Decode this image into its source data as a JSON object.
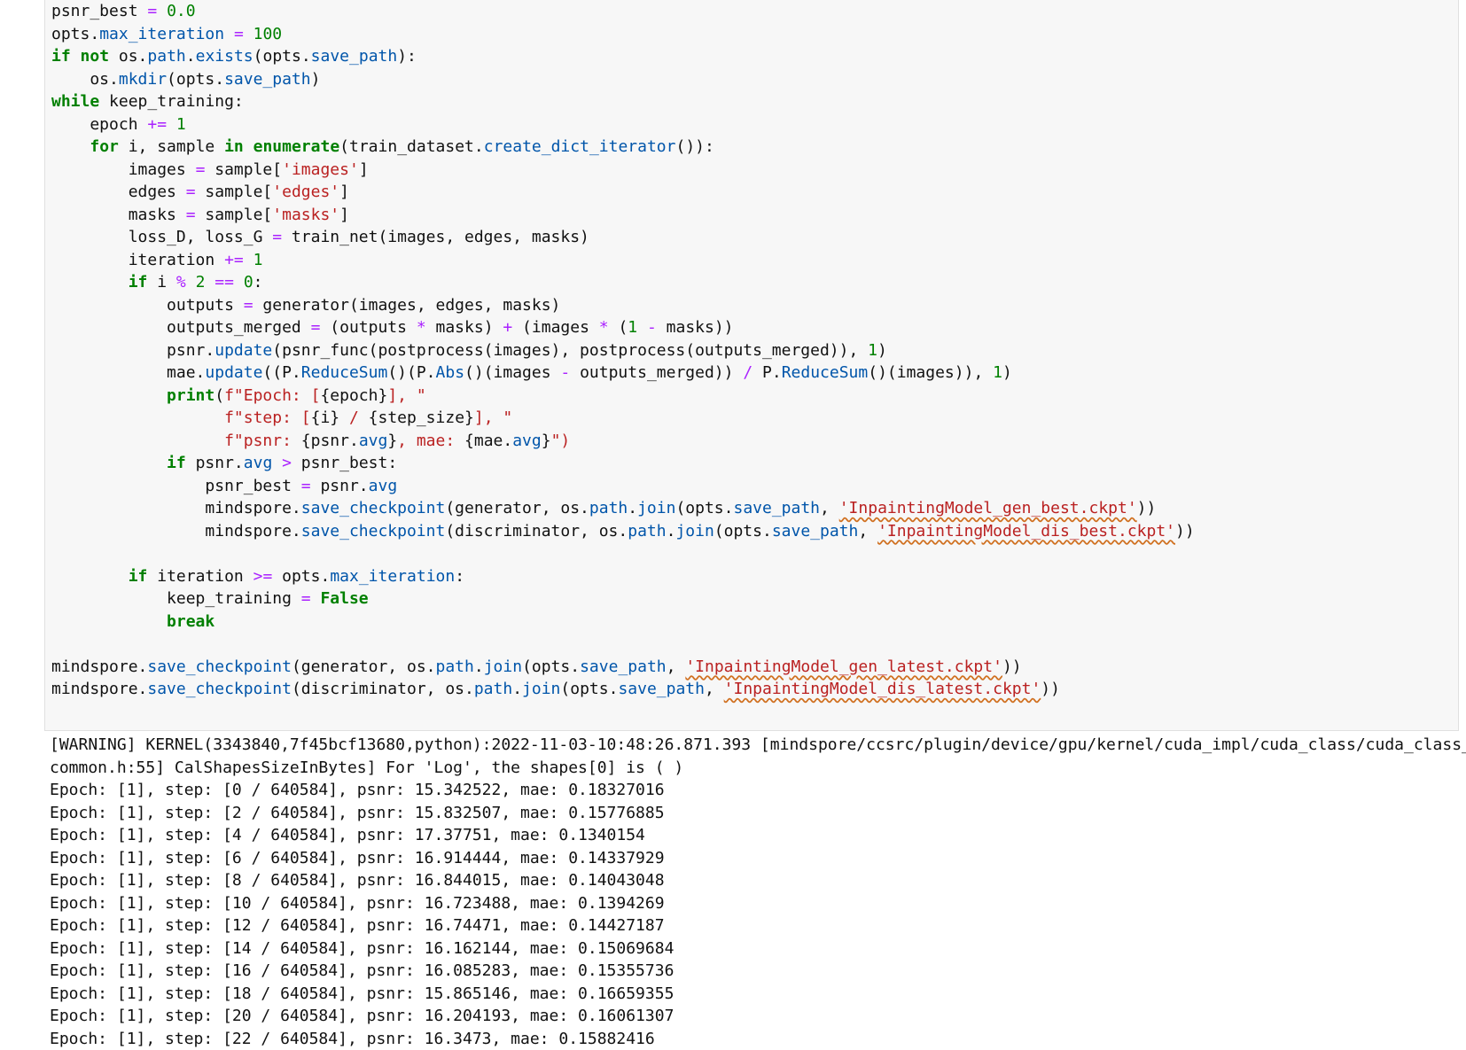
{
  "code_lines": [
    [
      [
        "psnr_best ",
        "var"
      ],
      [
        "=",
        "op"
      ],
      [
        " ",
        "var"
      ],
      [
        "0.0",
        "num"
      ]
    ],
    [
      [
        "opts",
        "var"
      ],
      [
        ".",
        "var"
      ],
      [
        "max_iteration",
        "attr"
      ],
      [
        " ",
        "var"
      ],
      [
        "=",
        "op"
      ],
      [
        " ",
        "var"
      ],
      [
        "100",
        "num"
      ]
    ],
    [
      [
        "if",
        "kw"
      ],
      [
        " ",
        "var"
      ],
      [
        "not",
        "kw"
      ],
      [
        " os.",
        "var"
      ],
      [
        "path",
        "attr"
      ],
      [
        ".",
        "var"
      ],
      [
        "exists",
        "attr"
      ],
      [
        "(opts.",
        "var"
      ],
      [
        "save_path",
        "attr"
      ],
      [
        "):",
        "var"
      ]
    ],
    [
      [
        "    os.",
        "var"
      ],
      [
        "mkdir",
        "attr"
      ],
      [
        "(opts.",
        "var"
      ],
      [
        "save_path",
        "attr"
      ],
      [
        ")",
        "var"
      ]
    ],
    [
      [
        "while",
        "kw"
      ],
      [
        " keep_training:",
        "var"
      ]
    ],
    [
      [
        "    epoch ",
        "var"
      ],
      [
        "+=",
        "op"
      ],
      [
        " ",
        "var"
      ],
      [
        "1",
        "num"
      ]
    ],
    [
      [
        "    ",
        "var"
      ],
      [
        "for",
        "kw"
      ],
      [
        " i, sample ",
        "var"
      ],
      [
        "in",
        "kw"
      ],
      [
        " ",
        "var"
      ],
      [
        "enumerate",
        "kw"
      ],
      [
        "(train_dataset.",
        "var"
      ],
      [
        "create_dict_iterator",
        "attr"
      ],
      [
        "()):",
        "var"
      ]
    ],
    [
      [
        "        images ",
        "var"
      ],
      [
        "=",
        "op"
      ],
      [
        " sample[",
        "var"
      ],
      [
        "'images'",
        "str"
      ],
      [
        "]",
        "var"
      ]
    ],
    [
      [
        "        edges ",
        "var"
      ],
      [
        "=",
        "op"
      ],
      [
        " sample[",
        "var"
      ],
      [
        "'edges'",
        "str"
      ],
      [
        "]",
        "var"
      ]
    ],
    [
      [
        "        masks ",
        "var"
      ],
      [
        "=",
        "op"
      ],
      [
        " sample[",
        "var"
      ],
      [
        "'masks'",
        "str"
      ],
      [
        "]",
        "var"
      ]
    ],
    [
      [
        "        loss_D, loss_G ",
        "var"
      ],
      [
        "=",
        "op"
      ],
      [
        " train_net(images, edges, masks)",
        "var"
      ]
    ],
    [
      [
        "        iteration ",
        "var"
      ],
      [
        "+=",
        "op"
      ],
      [
        " ",
        "var"
      ],
      [
        "1",
        "num"
      ]
    ],
    [
      [
        "        ",
        "var"
      ],
      [
        "if",
        "kw"
      ],
      [
        " i ",
        "var"
      ],
      [
        "%",
        "op"
      ],
      [
        " ",
        "var"
      ],
      [
        "2",
        "num"
      ],
      [
        " ",
        "var"
      ],
      [
        "==",
        "op"
      ],
      [
        " ",
        "var"
      ],
      [
        "0",
        "num"
      ],
      [
        ":",
        "var"
      ]
    ],
    [
      [
        "            outputs ",
        "var"
      ],
      [
        "=",
        "op"
      ],
      [
        " generator(images, edges, masks)",
        "var"
      ]
    ],
    [
      [
        "            outputs_merged ",
        "var"
      ],
      [
        "=",
        "op"
      ],
      [
        " (outputs ",
        "var"
      ],
      [
        "*",
        "op"
      ],
      [
        " masks) ",
        "var"
      ],
      [
        "+",
        "op"
      ],
      [
        " (images ",
        "var"
      ],
      [
        "*",
        "op"
      ],
      [
        " (",
        "var"
      ],
      [
        "1",
        "num"
      ],
      [
        " ",
        "var"
      ],
      [
        "-",
        "op"
      ],
      [
        " masks))",
        "var"
      ]
    ],
    [
      [
        "            psnr.",
        "var"
      ],
      [
        "update",
        "attr"
      ],
      [
        "(psnr_func(postprocess(images), postprocess(outputs_merged)), ",
        "var"
      ],
      [
        "1",
        "num"
      ],
      [
        ")",
        "var"
      ]
    ],
    [
      [
        "            mae.",
        "var"
      ],
      [
        "update",
        "attr"
      ],
      [
        "((P.",
        "var"
      ],
      [
        "ReduceSum",
        "attr"
      ],
      [
        "()(P.",
        "var"
      ],
      [
        "Abs",
        "attr"
      ],
      [
        "()(images ",
        "var"
      ],
      [
        "-",
        "op"
      ],
      [
        " outputs_merged)) ",
        "var"
      ],
      [
        "/",
        "op"
      ],
      [
        " P.",
        "var"
      ],
      [
        "ReduceSum",
        "attr"
      ],
      [
        "()(images)), ",
        "var"
      ],
      [
        "1",
        "num"
      ],
      [
        ")",
        "var"
      ]
    ],
    [
      [
        "            ",
        "var"
      ],
      [
        "print",
        "kw"
      ],
      [
        "(",
        "var"
      ],
      [
        "f\"Epoch: [",
        "str"
      ],
      [
        "{epoch}",
        "var"
      ],
      [
        "], \"",
        "str"
      ]
    ],
    [
      [
        "                  ",
        "var"
      ],
      [
        "f\"step: [",
        "str"
      ],
      [
        "{i}",
        "var"
      ],
      [
        " / ",
        "str"
      ],
      [
        "{step_size}",
        "var"
      ],
      [
        "], \"",
        "str"
      ]
    ],
    [
      [
        "                  ",
        "var"
      ],
      [
        "f\"psnr: ",
        "str"
      ],
      [
        "{psnr.",
        "var"
      ],
      [
        "avg",
        "attr"
      ],
      [
        "}",
        "var"
      ],
      [
        ", mae: ",
        "str"
      ],
      [
        "{mae.",
        "var"
      ],
      [
        "avg",
        "attr"
      ],
      [
        "}",
        "var"
      ],
      [
        "\")",
        "str"
      ]
    ],
    [
      [
        "            ",
        "var"
      ],
      [
        "if",
        "kw"
      ],
      [
        " psnr.",
        "var"
      ],
      [
        "avg",
        "attr"
      ],
      [
        " ",
        "var"
      ],
      [
        ">",
        "op"
      ],
      [
        " psnr_best:",
        "var"
      ]
    ],
    [
      [
        "                psnr_best ",
        "var"
      ],
      [
        "=",
        "op"
      ],
      [
        " psnr.",
        "var"
      ],
      [
        "avg",
        "attr"
      ]
    ],
    [
      [
        "                mindspore.",
        "var"
      ],
      [
        "save_checkpoint",
        "attr"
      ],
      [
        "(generator, os.",
        "var"
      ],
      [
        "path",
        "attr"
      ],
      [
        ".",
        "var"
      ],
      [
        "join",
        "attr"
      ],
      [
        "(opts.",
        "var"
      ],
      [
        "save_path",
        "attr"
      ],
      [
        ", ",
        "var"
      ],
      [
        "'InpaintingModel_gen_best.ckpt'",
        "str"
      ],
      [
        "))",
        "var"
      ]
    ],
    [
      [
        "                mindspore.",
        "var"
      ],
      [
        "save_checkpoint",
        "attr"
      ],
      [
        "(discriminator, os.",
        "var"
      ],
      [
        "path",
        "attr"
      ],
      [
        ".",
        "var"
      ],
      [
        "join",
        "attr"
      ],
      [
        "(opts.",
        "var"
      ],
      [
        "save_path",
        "attr"
      ],
      [
        ", ",
        "var"
      ],
      [
        "'InpaintingModel_dis_best.ckpt'",
        "str"
      ],
      [
        "))",
        "var"
      ]
    ],
    [
      [
        "",
        "var"
      ]
    ],
    [
      [
        "        ",
        "var"
      ],
      [
        "if",
        "kw"
      ],
      [
        " iteration ",
        "var"
      ],
      [
        ">=",
        "op"
      ],
      [
        " opts.",
        "var"
      ],
      [
        "max_iteration",
        "attr"
      ],
      [
        ":",
        "var"
      ]
    ],
    [
      [
        "            keep_training ",
        "var"
      ],
      [
        "=",
        "op"
      ],
      [
        " ",
        "var"
      ],
      [
        "False",
        "kw"
      ]
    ],
    [
      [
        "            ",
        "var"
      ],
      [
        "break",
        "kw"
      ]
    ],
    [
      [
        "",
        "var"
      ]
    ],
    [
      [
        "mindspore.",
        "var"
      ],
      [
        "save_checkpoint",
        "attr"
      ],
      [
        "(generator, os.",
        "var"
      ],
      [
        "path",
        "attr"
      ],
      [
        ".",
        "var"
      ],
      [
        "join",
        "attr"
      ],
      [
        "(opts.",
        "var"
      ],
      [
        "save_path",
        "attr"
      ],
      [
        ", ",
        "var"
      ],
      [
        "'InpaintingModel_gen_latest.ckpt'",
        "str"
      ],
      [
        "))",
        "var"
      ]
    ],
    [
      [
        "mindspore.",
        "var"
      ],
      [
        "save_checkpoint",
        "attr"
      ],
      [
        "(discriminator, os.",
        "var"
      ],
      [
        "path",
        "attr"
      ],
      [
        ".",
        "var"
      ],
      [
        "join",
        "attr"
      ],
      [
        "(opts.",
        "var"
      ],
      [
        "save_path",
        "attr"
      ],
      [
        ", ",
        "var"
      ],
      [
        "'InpaintingModel_dis_latest.ckpt'",
        "str"
      ],
      [
        "))",
        "var"
      ]
    ]
  ],
  "output_lines": [
    "[WARNING] KERNEL(3343840,7f45bcf13680,python):2022-11-03-10:48:26.871.393 [mindspore/ccsrc/plugin/device/gpu/kernel/cuda_impl/cuda_class/cuda_class_",
    "common.h:55] CalShapesSizeInBytes] For 'Log', the shapes[0] is ( )",
    "Epoch: [1], step: [0 / 640584], psnr: 15.342522, mae: 0.18327016",
    "Epoch: [1], step: [2 / 640584], psnr: 15.832507, mae: 0.15776885",
    "Epoch: [1], step: [4 / 640584], psnr: 17.37751, mae: 0.1340154",
    "Epoch: [1], step: [6 / 640584], psnr: 16.914444, mae: 0.14337929",
    "Epoch: [1], step: [8 / 640584], psnr: 16.844015, mae: 0.14043048",
    "Epoch: [1], step: [10 / 640584], psnr: 16.723488, mae: 0.1394269",
    "Epoch: [1], step: [12 / 640584], psnr: 16.74471, mae: 0.14427187",
    "Epoch: [1], step: [14 / 640584], psnr: 16.162144, mae: 0.15069684",
    "Epoch: [1], step: [16 / 640584], psnr: 16.085283, mae: 0.15355736",
    "Epoch: [1], step: [18 / 640584], psnr: 15.865146, mae: 0.16659355",
    "Epoch: [1], step: [20 / 640584], psnr: 16.204193, mae: 0.16061307",
    "Epoch: [1], step: [22 / 640584], psnr: 16.3473, mae: 0.15882416"
  ],
  "colors": {
    "keyword": "#008000",
    "operator": "#aa22ff",
    "number": "#008000",
    "string": "#ba2121",
    "attribute": "#0055aa",
    "cell_background": "#f7f7f7"
  }
}
